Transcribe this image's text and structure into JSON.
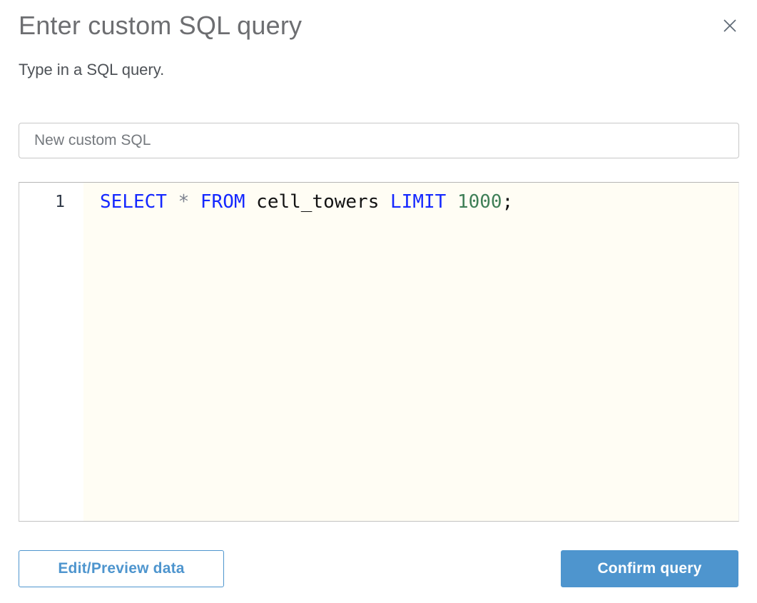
{
  "dialog": {
    "title": "Enter custom SQL query",
    "subtitle": "Type in a SQL query."
  },
  "name_input": {
    "value": "New custom SQL"
  },
  "editor": {
    "lines": [
      {
        "number": "1",
        "tokens": [
          {
            "text": "SELECT",
            "type": "keyword"
          },
          {
            "text": " ",
            "type": "plain"
          },
          {
            "text": "*",
            "type": "operator"
          },
          {
            "text": " ",
            "type": "plain"
          },
          {
            "text": "FROM",
            "type": "keyword"
          },
          {
            "text": " cell_towers ",
            "type": "plain"
          },
          {
            "text": "LIMIT",
            "type": "keyword"
          },
          {
            "text": " ",
            "type": "plain"
          },
          {
            "text": "1000",
            "type": "number"
          },
          {
            "text": ";",
            "type": "plain"
          }
        ]
      }
    ]
  },
  "footer": {
    "secondary_label": "Edit/Preview data",
    "primary_label": "Confirm query"
  },
  "colors": {
    "accent_blue": "#4e95ce",
    "keyword": "#1528ff",
    "number": "#3f7f57",
    "operator": "#7d828f",
    "plain": "#131313",
    "code_bg": "#fffdf4"
  }
}
